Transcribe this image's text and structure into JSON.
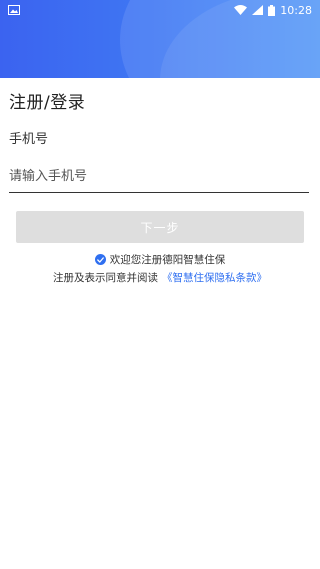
{
  "status_bar": {
    "time": "10:28",
    "icons": [
      "image-notification-icon",
      "wifi-icon",
      "signal-icon",
      "battery-icon"
    ]
  },
  "header": {
    "gradient_start": "#3b63f0",
    "gradient_end": "#4b92f7"
  },
  "form": {
    "title": "注册/登录",
    "phone_label": "手机号",
    "phone_placeholder": "请输入手机号",
    "phone_value": "",
    "next_button_label": "下一步"
  },
  "agreement": {
    "checked": true,
    "consent_text": "欢迎您注册德阳智慧住保",
    "terms_prefix": "注册及表示同意并阅读",
    "terms_link": "《智慧住保隐私条款》"
  },
  "colors": {
    "accent": "#2f6ff0",
    "button_disabled": "#dedede"
  }
}
